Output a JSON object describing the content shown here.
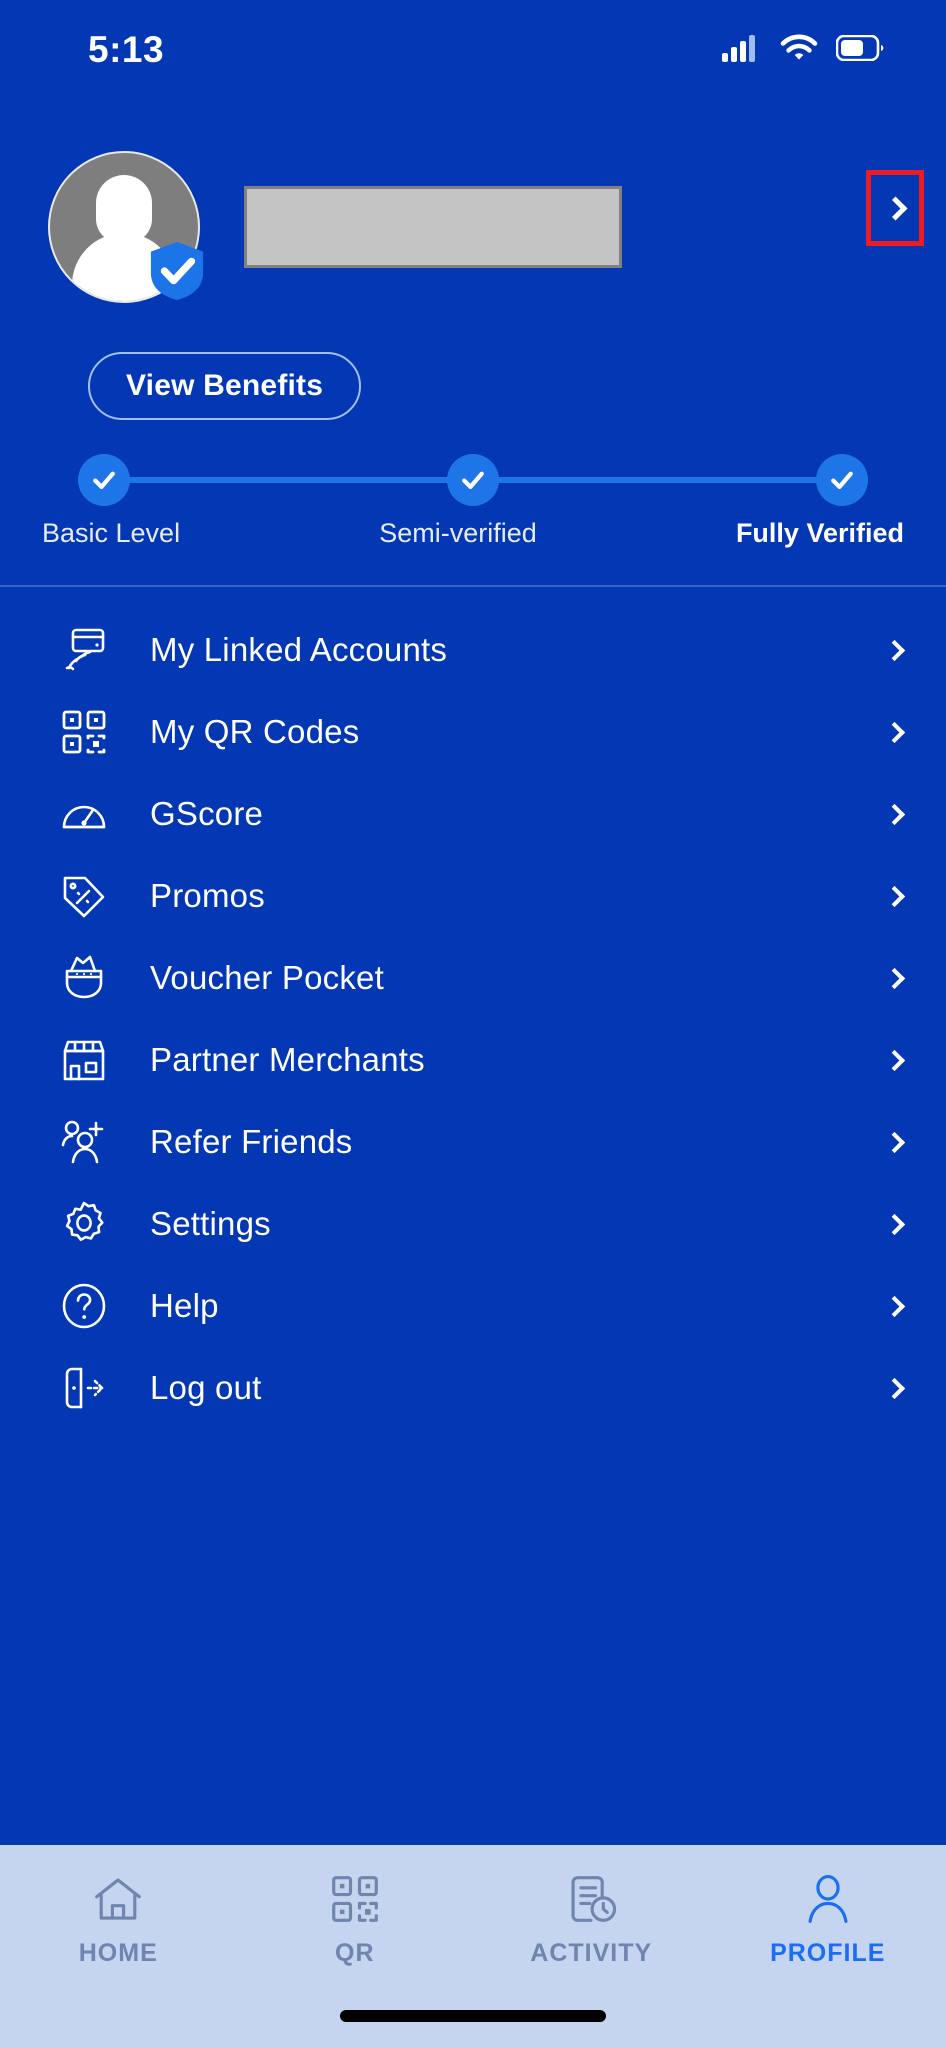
{
  "status_bar": {
    "time": "5:13",
    "icons": [
      "cellular-signal-icon",
      "wifi-icon",
      "battery-icon"
    ]
  },
  "theme": {
    "background": "#0437B3",
    "accent_blue": "#1E75E8",
    "active_nav": "#1B6EF3",
    "nav_background": "#C5D4EF",
    "nav_inactive": "#6F85AE",
    "highlight_red": "#ED1C24",
    "redaction_fill": "#C4C4C4",
    "redaction_border": "#808080",
    "text_white": "#FFFFFF"
  },
  "profile": {
    "avatar_name": "default-avatar",
    "verified_badge": "shield-check-icon",
    "name_value": "",
    "name_redacted": true,
    "chevron_label": "›",
    "chevron_highlighted": true,
    "benefits_button": "View Benefits"
  },
  "verification": {
    "steps": [
      {
        "label": "Basic Level",
        "complete": true,
        "current": false
      },
      {
        "label": "Semi-verified",
        "complete": true,
        "current": false
      },
      {
        "label": "Fully Verified",
        "complete": true,
        "current": true
      }
    ]
  },
  "menu": {
    "items": [
      {
        "label": "My Linked Accounts",
        "icon": "linked-card-icon"
      },
      {
        "label": "My QR Codes",
        "icon": "qr-code-icon"
      },
      {
        "label": "GScore",
        "icon": "speedometer-icon"
      },
      {
        "label": "Promos",
        "icon": "price-tag-icon"
      },
      {
        "label": "Voucher Pocket",
        "icon": "voucher-pocket-icon"
      },
      {
        "label": "Partner Merchants",
        "icon": "storefront-icon"
      },
      {
        "label": "Refer Friends",
        "icon": "add-person-icon"
      },
      {
        "label": "Settings",
        "icon": "gear-icon"
      },
      {
        "label": "Help",
        "icon": "question-circle-icon"
      },
      {
        "label": "Log out",
        "icon": "logout-door-icon"
      }
    ]
  },
  "bottom_nav": {
    "items": [
      {
        "label": "HOME",
        "icon": "home-icon",
        "active": false
      },
      {
        "label": "QR",
        "icon": "qr-code-icon",
        "active": false
      },
      {
        "label": "ACTIVITY",
        "icon": "activity-clock-icon",
        "active": false
      },
      {
        "label": "PROFILE",
        "icon": "person-icon",
        "active": true
      }
    ]
  }
}
